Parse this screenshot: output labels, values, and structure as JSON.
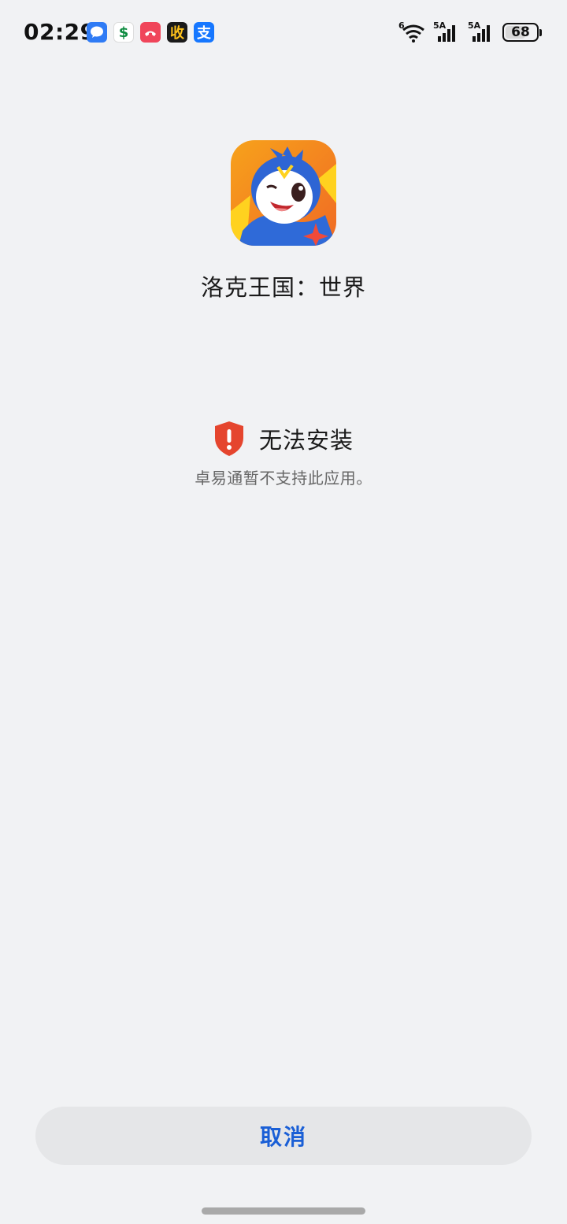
{
  "status_bar": {
    "time": "02:29",
    "notifications": [
      {
        "name": "messages-icon",
        "glyph": ""
      },
      {
        "name": "china-post-icon",
        "glyph": "$"
      },
      {
        "name": "phone-icon",
        "glyph": ""
      },
      {
        "name": "cashier-icon",
        "glyph": "收"
      },
      {
        "name": "alipay-icon",
        "glyph": "支"
      }
    ],
    "wifi_label": "6",
    "sim1_label": "5A",
    "sim2_label": "5A",
    "battery_level": "68"
  },
  "app": {
    "name": "洛克王国：世界"
  },
  "error": {
    "title": "无法安装",
    "description": "卓易通暂不支持此应用。",
    "color": "#e5452e"
  },
  "actions": {
    "cancel_label": "取消",
    "accent": "#1a5fd6"
  }
}
